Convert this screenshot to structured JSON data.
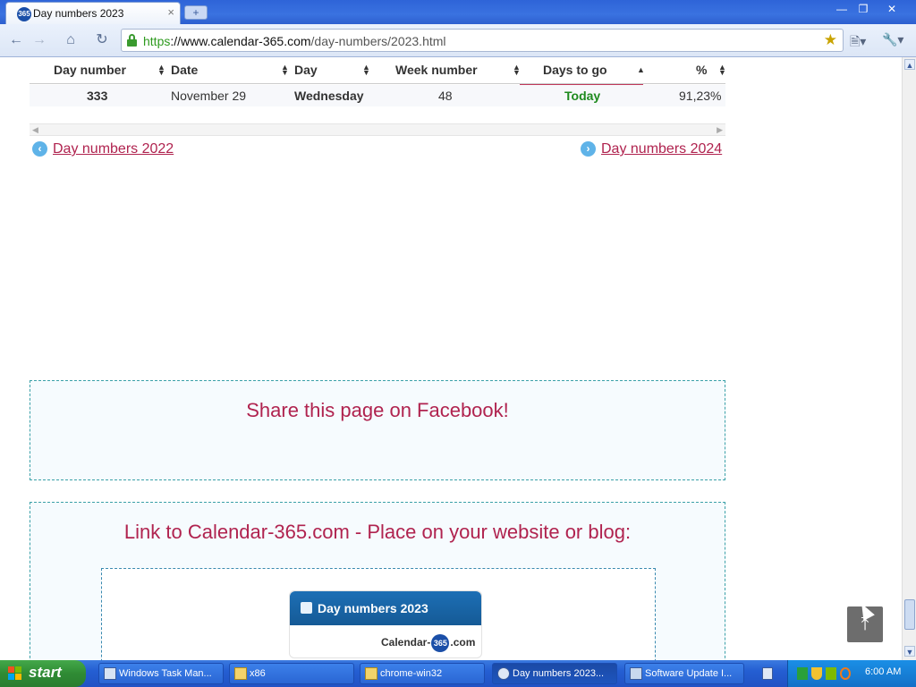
{
  "browser": {
    "tab_title": "Day numbers 2023",
    "tab_favicon_text": "365",
    "new_tab_symbol": "+",
    "url_scheme": "https",
    "url_host": "://www.calendar-365.com",
    "url_path": "/day-numbers/2023.html"
  },
  "table": {
    "headers": [
      "Day number",
      "Date",
      "Day",
      "Week number",
      "Days to go",
      "%"
    ],
    "sorted_column": "Days to go",
    "row": {
      "day_number": "333",
      "date": "November 29",
      "day": "Wednesday",
      "week_number": "48",
      "days_to_go": "Today",
      "percent": "91,23%"
    }
  },
  "navigation": {
    "prev_label": "Day numbers 2022",
    "next_label": "Day numbers 2024"
  },
  "share": {
    "facebook_text": "Share this page on Facebook!"
  },
  "link_section": {
    "heading": "Link to Calendar-365.com - Place on your website or blog:",
    "widget_title": "Day numbers 2023",
    "widget_brand_left": "Calendar-",
    "widget_brand_badge": "365",
    "widget_brand_right": ".com"
  },
  "taskbar": {
    "start_label": "start",
    "tasks": [
      {
        "label": "Windows Task Man..."
      },
      {
        "label": "x86"
      },
      {
        "label": "chrome-win32"
      },
      {
        "label": "Day numbers 2023..."
      },
      {
        "label": "Software Update I..."
      }
    ],
    "clock": "6:00 AM"
  },
  "colors": {
    "link": "#b0234f",
    "today": "#1e8a1e",
    "accent_underline": "#c0395a",
    "taskbar": "#245ed2"
  }
}
